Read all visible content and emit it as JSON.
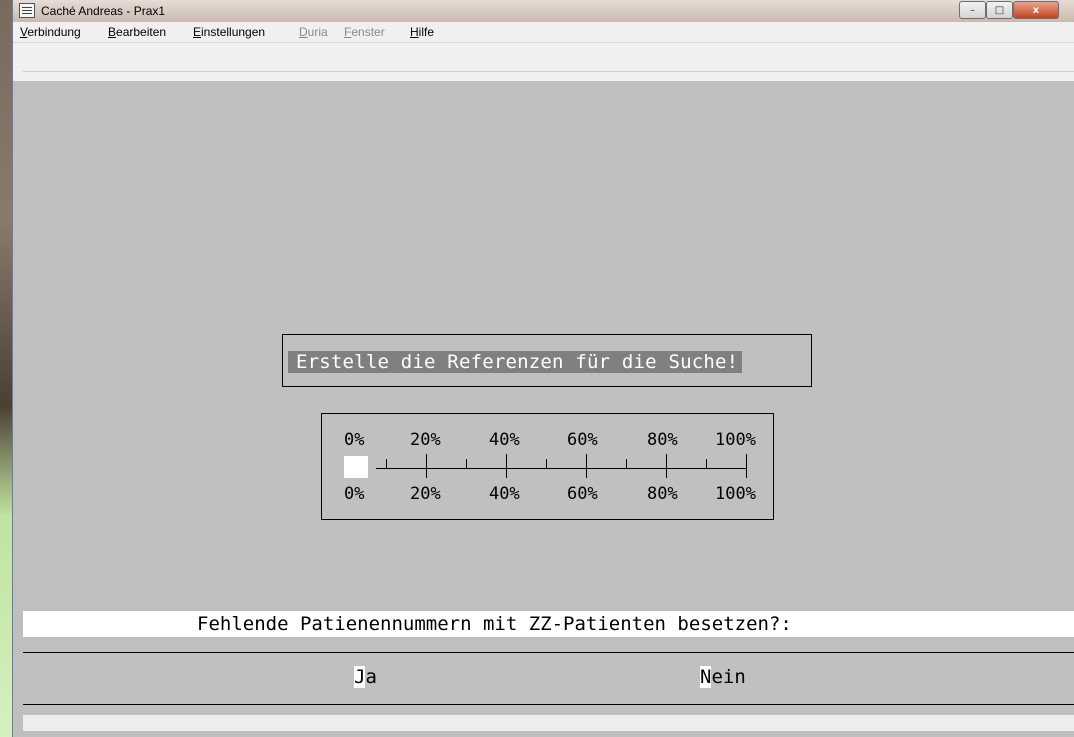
{
  "window": {
    "title": "Caché Andreas - Prax1"
  },
  "titlebar_buttons": {
    "minimize": "–",
    "maximize": "□",
    "close": "x"
  },
  "menu": [
    {
      "key": "V",
      "rest": "erbindung",
      "enabled": true
    },
    {
      "key": "B",
      "rest": "earbeiten",
      "enabled": true
    },
    {
      "key": "E",
      "rest": "instellungen",
      "enabled": true
    },
    {
      "key": "D",
      "rest": "uria",
      "enabled": false
    },
    {
      "key": "F",
      "rest": "enster",
      "enabled": false
    },
    {
      "key": "H",
      "rest": "ilfe",
      "enabled": true
    }
  ],
  "reference_message": "Erstelle die Referenzen für die Suche!",
  "progress": {
    "labels_top": [
      "0%",
      "20%",
      "40%",
      "60%",
      "80%",
      "100%"
    ],
    "labels_bottom": [
      "0%",
      "20%",
      "40%",
      "60%",
      "80%",
      "100%"
    ],
    "value_percent": 0
  },
  "question": "Fehlende Patienennummern mit ZZ-Patienten besetzen?:",
  "choices": {
    "yes": {
      "hotkey": "J",
      "rest": "a"
    },
    "no": {
      "hotkey": "N",
      "rest": "ein"
    }
  },
  "colors": {
    "terminal_background": "#c0c0c0",
    "highlight": "#ffffff",
    "message_background": "#808080"
  }
}
